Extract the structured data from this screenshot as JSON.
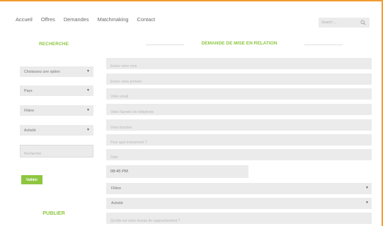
{
  "nav": {
    "items": [
      "Accueil",
      "Offres",
      "Demandes",
      "Matchmaking",
      "Contact"
    ]
  },
  "search": {
    "placeholder": "Search ..."
  },
  "left": {
    "title": "RECHERCHE",
    "selects": [
      "Choisissez une option",
      "Pays",
      "Filière",
      "Activité"
    ],
    "input_placeholder": "Recherche",
    "button_label": "Valider",
    "publish_title": "PUBLIER"
  },
  "right": {
    "title": "DEMANDE DE MISE EN RELATION",
    "fields": [
      "Entrer votre nom",
      "Entrer votre prénom",
      "Votre email",
      "Votre Numéro de téléphone",
      "Votre fonction",
      "Pour quel évènement ?",
      "Date"
    ],
    "time_value": "08:45 PM",
    "selects": [
      "Filière",
      "Activité"
    ],
    "last_field": "Qu'elle est votre niveau de rapprochement ?"
  },
  "colors": {
    "accent": "#8dc63f",
    "frame": "#f29a2e",
    "field_bg": "#ebebeb"
  }
}
